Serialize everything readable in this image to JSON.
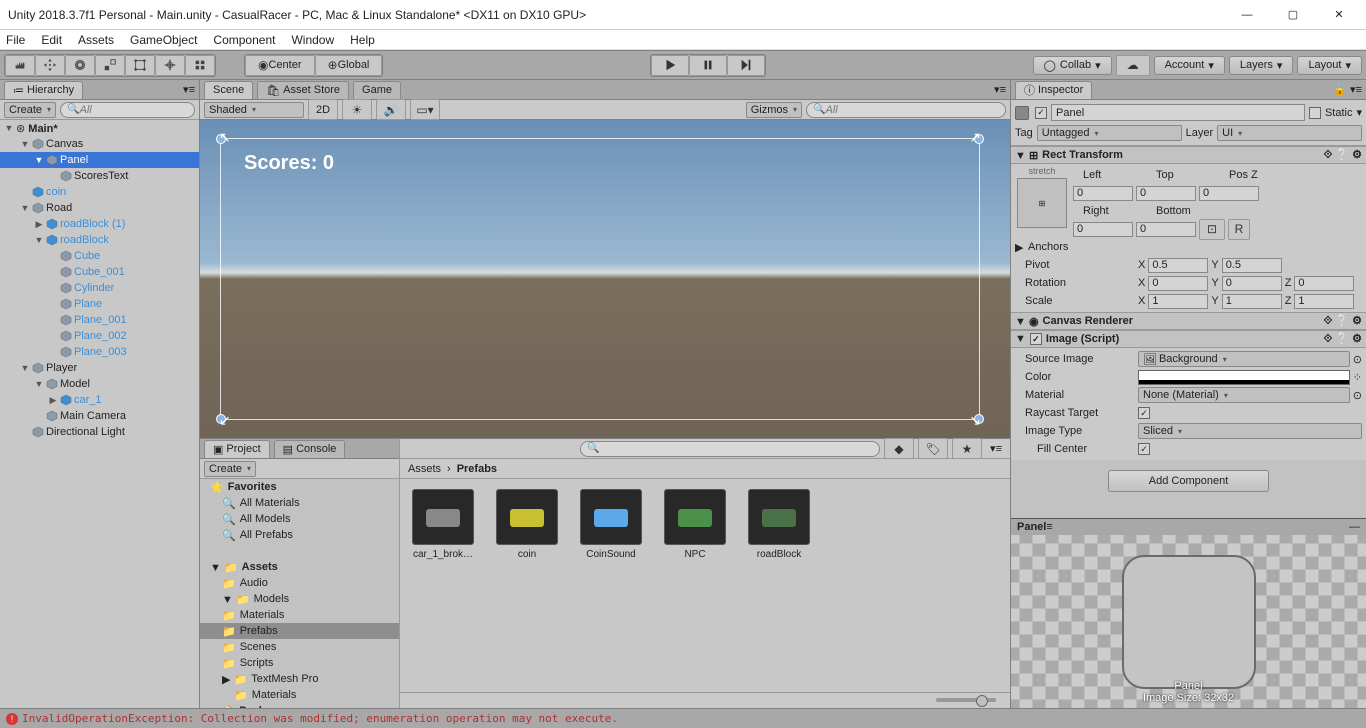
{
  "window": {
    "title": "Unity 2018.3.7f1 Personal - Main.unity - CasualRacer - PC, Mac & Linux Standalone* <DX11 on DX10 GPU>"
  },
  "menu": [
    "File",
    "Edit",
    "Assets",
    "GameObject",
    "Component",
    "Window",
    "Help"
  ],
  "toolbar": {
    "pivot_center": "Center",
    "pivot_global": "Global",
    "collab": "Collab",
    "account": "Account",
    "layers": "Layers",
    "layout": "Layout"
  },
  "hierarchy": {
    "tab": "Hierarchy",
    "create": "Create",
    "search_placeholder": "All",
    "scene": "Main*",
    "items": [
      {
        "d": 1,
        "f": "▼",
        "n": "Canvas",
        "c": "#8a9aa8"
      },
      {
        "d": 2,
        "f": "▼",
        "n": "Panel",
        "sel": true,
        "c": "#8a9aa8"
      },
      {
        "d": 3,
        "f": "",
        "n": "ScoresText",
        "c": "#8a9aa8"
      },
      {
        "d": 1,
        "f": "",
        "n": "coin",
        "c": "#3c8fd6",
        "pre": true
      },
      {
        "d": 1,
        "f": "▼",
        "n": "Road",
        "c": "#8a9aa8"
      },
      {
        "d": 2,
        "f": "▶",
        "n": "roadBlock (1)",
        "c": "#3c8fd6",
        "pre": true
      },
      {
        "d": 2,
        "f": "▼",
        "n": "roadBlock",
        "c": "#3c8fd6",
        "pre": true
      },
      {
        "d": 3,
        "f": "",
        "n": "Cube",
        "c": "#8a9aa8",
        "pre": true
      },
      {
        "d": 3,
        "f": "",
        "n": "Cube_001",
        "c": "#8a9aa8",
        "pre": true
      },
      {
        "d": 3,
        "f": "",
        "n": "Cylinder",
        "c": "#8a9aa8",
        "pre": true
      },
      {
        "d": 3,
        "f": "",
        "n": "Plane",
        "c": "#8a9aa8",
        "pre": true
      },
      {
        "d": 3,
        "f": "",
        "n": "Plane_001",
        "c": "#8a9aa8",
        "pre": true
      },
      {
        "d": 3,
        "f": "",
        "n": "Plane_002",
        "c": "#8a9aa8",
        "pre": true
      },
      {
        "d": 3,
        "f": "",
        "n": "Plane_003",
        "c": "#8a9aa8",
        "pre": true
      },
      {
        "d": 1,
        "f": "▼",
        "n": "Player",
        "c": "#8a9aa8"
      },
      {
        "d": 2,
        "f": "▼",
        "n": "Model",
        "c": "#8a9aa8"
      },
      {
        "d": 3,
        "f": "▶",
        "n": "car_1",
        "c": "#3c8fd6",
        "pre": true
      },
      {
        "d": 2,
        "f": "",
        "n": "Main Camera",
        "c": "#8a9aa8"
      },
      {
        "d": 1,
        "f": "",
        "n": "Directional Light",
        "c": "#8a9aa8"
      }
    ]
  },
  "scene": {
    "tab_scene": "Scene",
    "tab_asset_store": "Asset Store",
    "tab_game": "Game",
    "shaded": "Shaded",
    "mode_2d": "2D",
    "gizmos": "Gizmos",
    "search_placeholder": "All",
    "overlay_text": "Scores: 0"
  },
  "project": {
    "tab_project": "Project",
    "tab_console": "Console",
    "create": "Create",
    "favorites": "Favorites",
    "fav_items": [
      "All Materials",
      "All Models",
      "All Prefabs"
    ],
    "assets": "Assets",
    "folders": [
      "Audio",
      "Models",
      "Materials",
      "Prefabs",
      "Scenes",
      "Scripts",
      "TextMesh Pro"
    ],
    "packages": "Packages",
    "crumb": [
      "Assets",
      "Prefabs"
    ],
    "grid_items": [
      "car_1_brok…",
      "coin",
      "CoinSound",
      "NPC",
      "roadBlock"
    ]
  },
  "inspector": {
    "tab": "Inspector",
    "object_name": "Panel",
    "static": "Static",
    "tag_label": "Tag",
    "tag_value": "Untagged",
    "layer_label": "Layer",
    "layer_value": "UI",
    "rect_transform": {
      "title": "Rect Transform",
      "stretch": "stretch",
      "left": "Left",
      "top": "Top",
      "posz": "Pos Z",
      "right": "Right",
      "bottom": "Bottom",
      "left_v": "0",
      "top_v": "0",
      "posz_v": "0",
      "right_v": "0",
      "bottom_v": "0",
      "anchors": "Anchors",
      "pivot": "Pivot",
      "pivot_x": "0.5",
      "pivot_y": "0.5",
      "rotation": "Rotation",
      "rot_x": "0",
      "rot_y": "0",
      "rot_z": "0",
      "scale": "Scale",
      "scl_x": "1",
      "scl_y": "1",
      "scl_z": "1",
      "R": "R"
    },
    "canvas_renderer": "Canvas Renderer",
    "image": {
      "title": "Image (Script)",
      "source": "Source Image",
      "source_v": "Background",
      "color": "Color",
      "material": "Material",
      "material_v": "None (Material)",
      "raycast": "Raycast Target",
      "image_type": "Image Type",
      "image_type_v": "Sliced",
      "fill_center": "Fill Center"
    },
    "add_component": "Add Component",
    "preview_title": "Panel",
    "preview_caption": "Panel\nImage Size: 32x32"
  },
  "status": {
    "error": "InvalidOperationException: Collection was modified; enumeration operation may not execute."
  }
}
